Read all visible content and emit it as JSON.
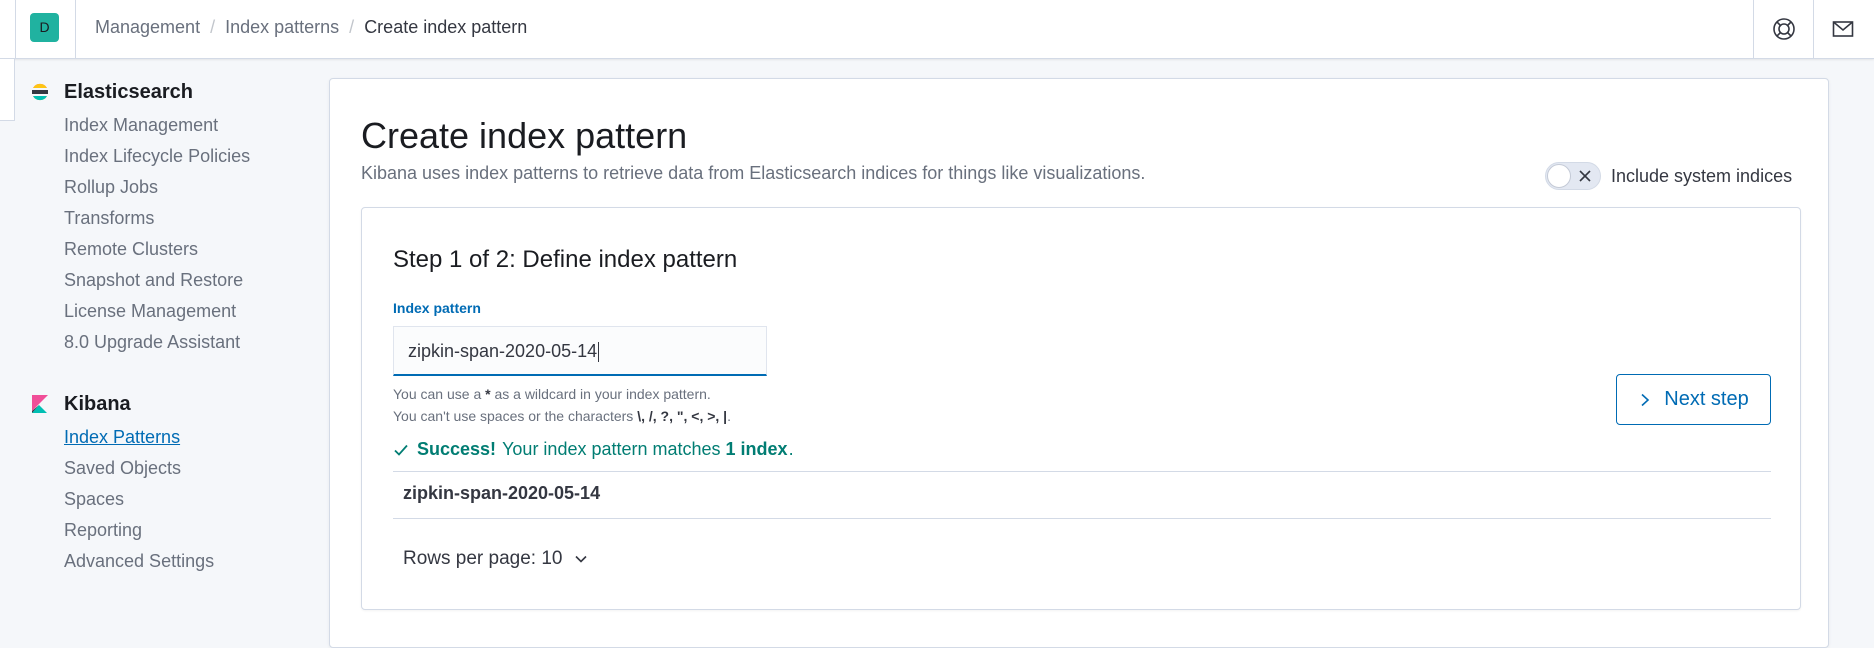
{
  "header": {
    "avatar_letter": "D",
    "breadcrumbs": [
      "Management",
      "Index patterns",
      "Create index pattern"
    ]
  },
  "sidebar": {
    "groups": [
      {
        "title": "Elasticsearch",
        "icon": "elasticsearch-logo",
        "items": [
          {
            "label": "Index Management"
          },
          {
            "label": "Index Lifecycle Policies"
          },
          {
            "label": "Rollup Jobs"
          },
          {
            "label": "Transforms"
          },
          {
            "label": "Remote Clusters"
          },
          {
            "label": "Snapshot and Restore"
          },
          {
            "label": "License Management"
          },
          {
            "label": "8.0 Upgrade Assistant"
          }
        ]
      },
      {
        "title": "Kibana",
        "icon": "kibana-logo",
        "items": [
          {
            "label": "Index Patterns",
            "active": true
          },
          {
            "label": "Saved Objects"
          },
          {
            "label": "Spaces"
          },
          {
            "label": "Reporting"
          },
          {
            "label": "Advanced Settings"
          }
        ]
      }
    ]
  },
  "main": {
    "title": "Create index pattern",
    "description": "Kibana uses index patterns to retrieve data from Elasticsearch indices for things like visualizations.",
    "toggle": {
      "label": "Include system indices",
      "on": false
    },
    "step": {
      "title": "Step 1 of 2: Define index pattern",
      "field_label": "Index pattern",
      "field_value": "zipkin-span-2020-05-14",
      "help_line1_a": "You can use a ",
      "help_line1_star": "*",
      "help_line1_b": " as a wildcard in your index pattern.",
      "help_line2_a": "You can't use spaces or the characters ",
      "help_line2_chars": "\\, /, ?, \", <, >, |",
      "help_line2_b": ".",
      "success_strong": "Success!",
      "success_text": "Your index pattern matches",
      "success_count": "1 index",
      "success_end": ".",
      "matched_indices": [
        "zipkin-span-2020-05-14"
      ],
      "rows_per_page": "Rows per page: 10",
      "next_button": "Next step"
    }
  },
  "colors": {
    "accent": "#006bb4",
    "success": "#017d73",
    "avatar_bg": "#20b2a0"
  }
}
